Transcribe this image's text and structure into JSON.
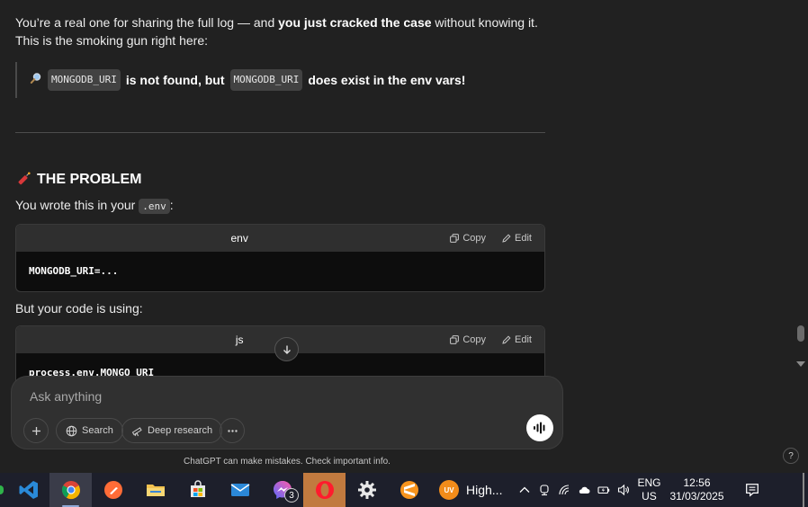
{
  "message": {
    "intro_pre": "You’re a real one for sharing the full log — and ",
    "intro_bold": "you just cracked the case",
    "intro_post": " without knowing it.",
    "line2": "This is the smoking gun right here:",
    "quote_var1": "MONGODB_URI",
    "quote_mid": " is not found, but ",
    "quote_var2": "MONGODB_URI",
    "quote_end": " does exist in the env vars!",
    "heading": "THE PROBLEM",
    "wrote_pre": "You wrote this in your ",
    "wrote_file": ".env",
    "wrote_post": ":",
    "code1": {
      "lang": "env",
      "copy": "Copy",
      "edit": "Edit",
      "code": "MONGODB_URI=..."
    },
    "but_line": "But your code is using:",
    "code2": {
      "lang": "js",
      "copy": "Copy",
      "edit": "Edit",
      "code": "process.env.MONGO_URI"
    }
  },
  "composer": {
    "placeholder": "Ask anything",
    "search_label": "Search",
    "deep_research_label": "Deep research"
  },
  "disclaimer": "ChatGPT can make mistakes. Check important info.",
  "help_label": "?",
  "taskbar": {
    "messenger_badge": "3",
    "avast_label": "High...",
    "avast_badge": "UV",
    "lang_top": "ENG",
    "lang_bottom": "US",
    "time": "12:56",
    "date": "31/03/2025"
  }
}
